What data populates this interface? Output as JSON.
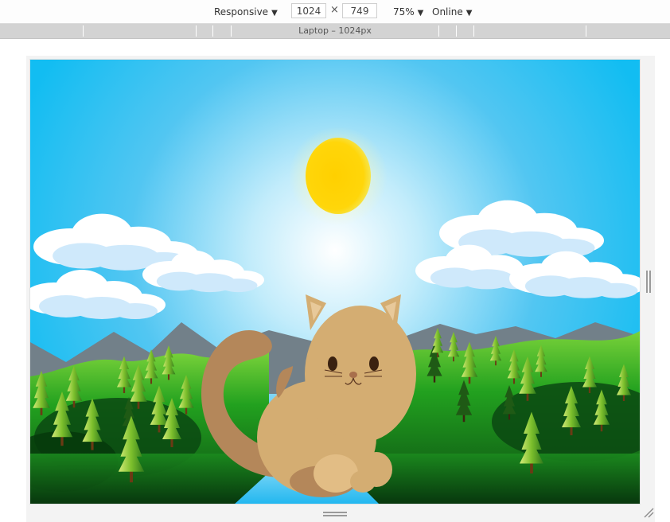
{
  "toolbar": {
    "device_label": "Responsive",
    "width_value": "1024",
    "times_symbol": "×",
    "height_value": "749",
    "zoom_label": "75%",
    "network_label": "Online"
  },
  "ruler": {
    "label": "Laptop – 1024px"
  },
  "icons": {
    "dropdown": "caret-down-icon",
    "resize": "resize-handle-icon"
  },
  "colors": {
    "sky_top": "#12bdf2",
    "sun": "#ffd60a",
    "cat_fur": "#d4ad72",
    "tail": "#b4875a",
    "grass": "#1b8a1e"
  }
}
